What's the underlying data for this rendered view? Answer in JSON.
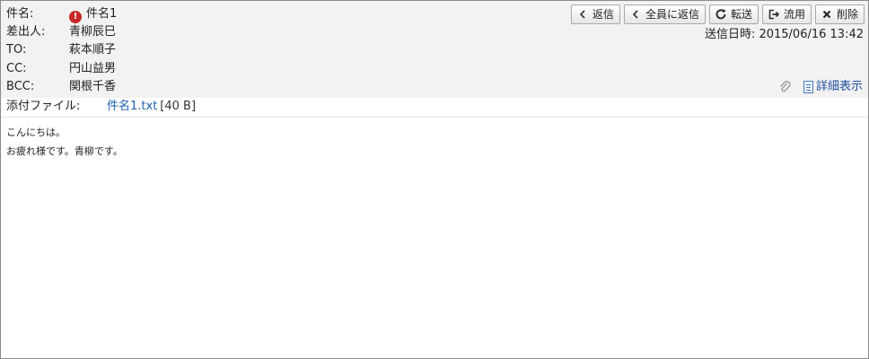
{
  "headers": {
    "subject": {
      "label": "件名:",
      "value": "件名1"
    },
    "from": {
      "label": "差出人:",
      "value": "青柳辰巳"
    },
    "to": {
      "label": "TO:",
      "value": "萩本順子"
    },
    "cc": {
      "label": "CC:",
      "value": "円山益男"
    },
    "bcc": {
      "label": "BCC:",
      "value": "関根千香"
    }
  },
  "toolbar": {
    "reply": "返信",
    "reply_all": "全員に返信",
    "forward": "転送",
    "reuse": "流用",
    "delete": "削除"
  },
  "sent": {
    "label": "送信日時:",
    "value": "2015/06/16 13:42"
  },
  "detail_link": "詳細表示",
  "attachment": {
    "label": "添付ファイル:",
    "filename": "件名1.txt",
    "size": "[40 B]"
  },
  "body": {
    "lines": [
      "こんにちは。",
      "お疲れ様です。青柳です。"
    ]
  },
  "colors": {
    "important": "#c62828",
    "link": "#1f5fb0"
  },
  "icons": {
    "important": "important-icon",
    "reply": "chevron-left-icon",
    "forward": "refresh-icon",
    "reuse": "export-icon",
    "delete": "close-icon",
    "attachment": "paperclip-icon",
    "detail": "document-icon"
  }
}
